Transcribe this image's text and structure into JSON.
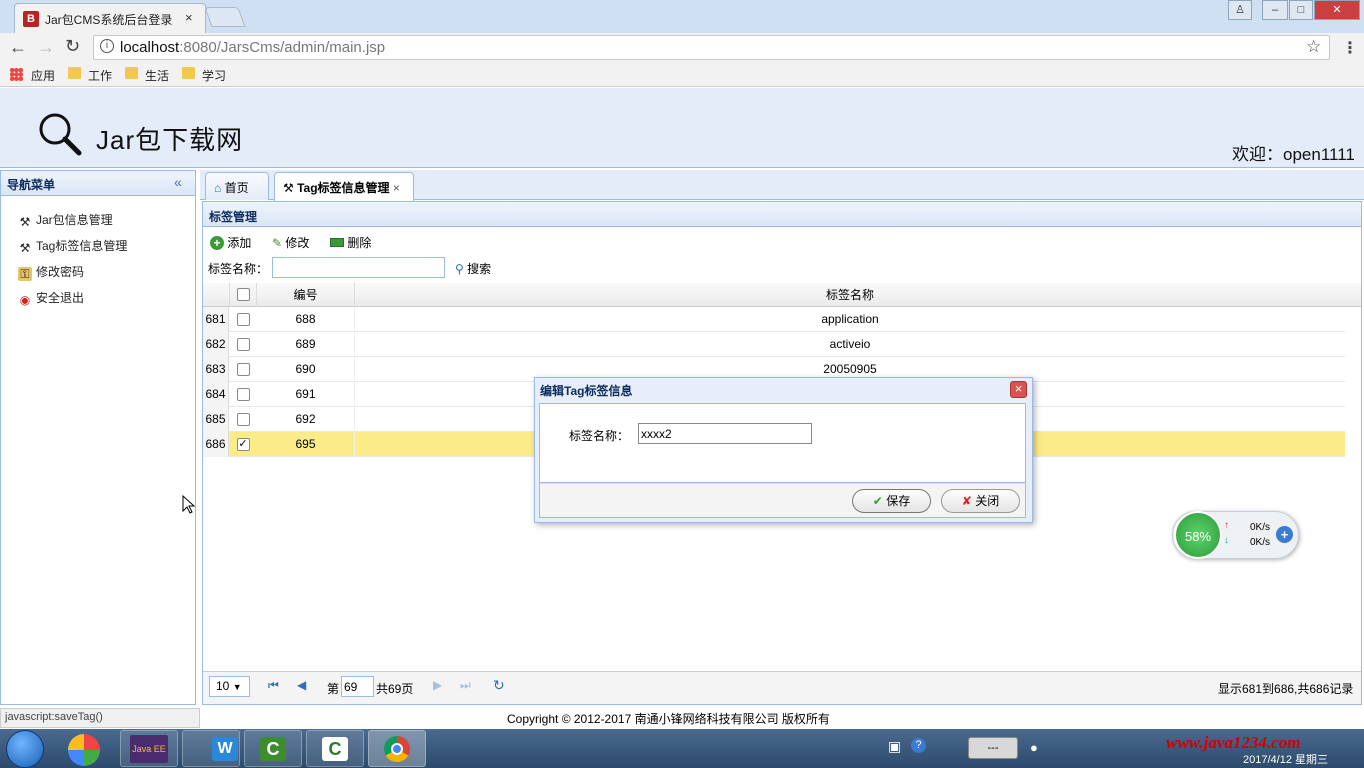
{
  "browser": {
    "tab_title": "Jar包CMS系统后台登录",
    "tab_favicon": "B",
    "tab_close": "×",
    "url_host": "localhost",
    "url_rest": ":8080/JarsCms/admin/main.jsp",
    "bookmarks": [
      "应用",
      "工作",
      "生活",
      "学习"
    ],
    "window_buttons": [
      "–",
      "□",
      "✕"
    ]
  },
  "app": {
    "logo_text": "Jar包下载网",
    "welcome": "欢迎：open1111"
  },
  "nav": {
    "title": "导航菜单",
    "collapse": "«",
    "items": [
      {
        "label": "Jar包信息管理",
        "icon": "tools-icon"
      },
      {
        "label": "Tag标签信息管理",
        "icon": "tools-icon"
      },
      {
        "label": "修改密码",
        "icon": "key-icon"
      },
      {
        "label": "安全退出",
        "icon": "exit-icon"
      }
    ]
  },
  "tabs": [
    {
      "label": "首页",
      "icon": "home-icon"
    },
    {
      "label": "Tag标签信息管理",
      "icon": "tools-icon",
      "close": "×"
    }
  ],
  "panel": {
    "title": "标签管理",
    "toolbar": {
      "add": "添加",
      "edit": "修改",
      "delete": "删除"
    },
    "search_label": "标签名称：",
    "search_value": "",
    "search_button": "搜索"
  },
  "grid": {
    "columns": [
      "编号",
      "标签名称"
    ],
    "rows": [
      {
        "rownum": "681",
        "id": "688",
        "name": "application",
        "checked": false
      },
      {
        "rownum": "682",
        "id": "689",
        "name": "activeio",
        "checked": false
      },
      {
        "rownum": "683",
        "id": "690",
        "name": "20050905",
        "checked": false
      },
      {
        "rownum": "684",
        "id": "691",
        "name": "",
        "checked": false
      },
      {
        "rownum": "685",
        "id": "692",
        "name": "",
        "checked": false
      },
      {
        "rownum": "686",
        "id": "695",
        "name": "",
        "checked": true
      }
    ]
  },
  "pager": {
    "page_size": "10",
    "page_prefix": "第",
    "page_current": "69",
    "page_total": "共69页",
    "summary": "显示681到686,共686记录"
  },
  "dialog": {
    "title": "编辑Tag标签信息",
    "field_label": "标签名称：",
    "field_value": "xxxx2",
    "save": "保存",
    "close": "关闭"
  },
  "status": {
    "link": "javascript:saveTag()",
    "copyright": "Copyright © 2012-2017 南通小锋网络科技有限公司 版权所有"
  },
  "net_widget": {
    "percent": "58%",
    "up": "0K/s",
    "down": "0K/s"
  },
  "taskbar": {
    "watermark": "www.java1234.com",
    "date": "2017/4/12 星期三",
    "battery": "---"
  },
  "colors": {
    "header_bg": "#e3ecf8",
    "selected_row": "#fbec88",
    "border": "#99bbe8",
    "watermark": "#d40000"
  }
}
